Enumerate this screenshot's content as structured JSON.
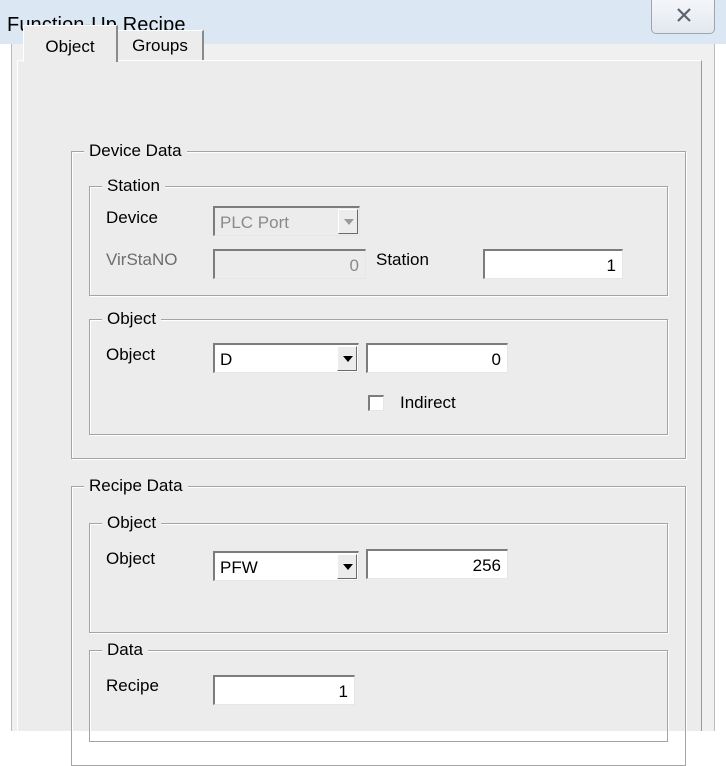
{
  "window": {
    "title": "Function-Up Recipe",
    "close_icon": "close-icon"
  },
  "tabs": [
    {
      "label": "Object",
      "active": true
    },
    {
      "label": "Groups",
      "active": false
    }
  ],
  "device_data": {
    "legend": "Device Data",
    "station_group": {
      "legend": "Station",
      "device_label": "Device",
      "device_value": "PLC Port",
      "virstano_label": "VirStaNO",
      "virstano_value": "0",
      "station_label": "Station",
      "station_value": "1"
    },
    "object_group": {
      "legend": "Object",
      "object_label": "Object",
      "object_type": "D",
      "object_address": "0",
      "indirect_label": "Indirect",
      "indirect_checked": false
    }
  },
  "recipe_data": {
    "legend": "Recipe Data",
    "object_group": {
      "legend": "Object",
      "object_label": "Object",
      "object_type": "PFW",
      "object_address": "256"
    },
    "data_group": {
      "legend": "Data",
      "recipe_label": "Recipe",
      "recipe_value": "1"
    }
  }
}
